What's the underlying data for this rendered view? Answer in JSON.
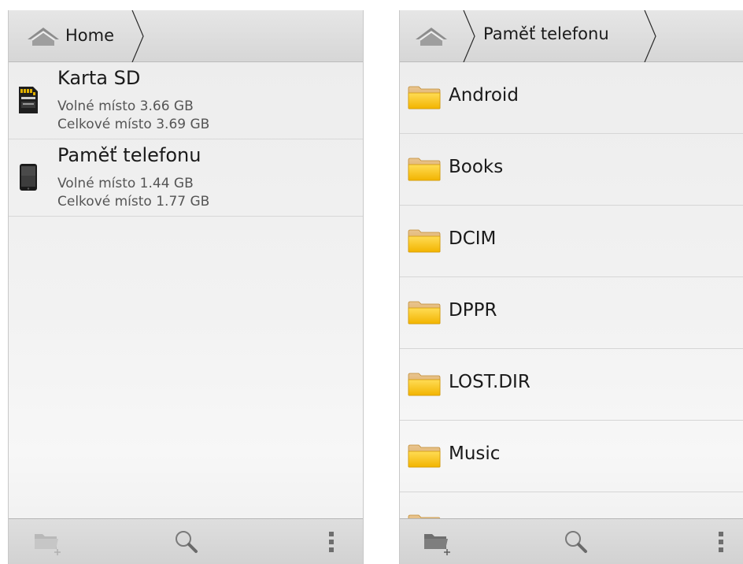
{
  "left_panel": {
    "breadcrumb": {
      "home_label": "Home"
    },
    "storage": [
      {
        "name": "Karta SD",
        "free": "Volné místo 3.66 GB",
        "total": "Celkové místo 3.69 GB",
        "icon": "sd-card-icon"
      },
      {
        "name": "Paměť telefonu",
        "free": "Volné místo 1.44 GB",
        "total": "Celkové místo 1.77 GB",
        "icon": "phone-icon"
      }
    ],
    "actions": {
      "new_folder_icon": "new-folder-icon",
      "search_icon": "search-icon",
      "overflow_icon": "overflow-menu-icon"
    }
  },
  "right_panel": {
    "breadcrumb": {
      "current": "Paměť telefonu"
    },
    "folders": [
      {
        "name": "Android"
      },
      {
        "name": "Books"
      },
      {
        "name": "DCIM"
      },
      {
        "name": "DPPR"
      },
      {
        "name": "LOST.DIR"
      },
      {
        "name": "Music"
      }
    ],
    "actions": {
      "new_folder_icon": "new-folder-icon",
      "search_icon": "search-icon",
      "overflow_icon": "overflow-menu-icon"
    }
  },
  "colors": {
    "folder_fill": "#f6c21a",
    "folder_tab": "#e7b25a",
    "icon_gray": "#7a7a7a",
    "icon_disabled": "#b0b0b0"
  }
}
